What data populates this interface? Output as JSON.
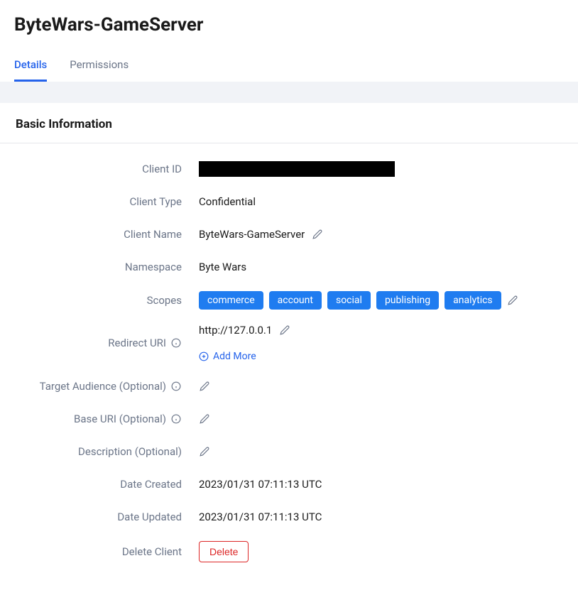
{
  "header": {
    "title": "ByteWars-GameServer"
  },
  "tabs": [
    {
      "label": "Details",
      "active": true
    },
    {
      "label": "Permissions",
      "active": false
    }
  ],
  "card": {
    "title": "Basic Information"
  },
  "fields": {
    "client_id": {
      "label": "Client ID"
    },
    "client_type": {
      "label": "Client Type",
      "value": "Confidential"
    },
    "client_name": {
      "label": "Client Name",
      "value": "ByteWars-GameServer"
    },
    "namespace": {
      "label": "Namespace",
      "value": "Byte Wars"
    },
    "scopes": {
      "label": "Scopes",
      "values": [
        "commerce",
        "account",
        "social",
        "publishing",
        "analytics"
      ]
    },
    "redirect_uri": {
      "label": "Redirect URI",
      "value": "http://127.0.0.1",
      "add_more": "Add More"
    },
    "target_audience": {
      "label": "Target Audience (Optional)"
    },
    "base_uri": {
      "label": "Base URI (Optional)"
    },
    "description": {
      "label": "Description (Optional)"
    },
    "date_created": {
      "label": "Date Created",
      "value": "2023/01/31 07:11:13 UTC"
    },
    "date_updated": {
      "label": "Date Updated",
      "value": "2023/01/31 07:11:13 UTC"
    },
    "delete_client": {
      "label": "Delete Client",
      "button": "Delete"
    }
  }
}
